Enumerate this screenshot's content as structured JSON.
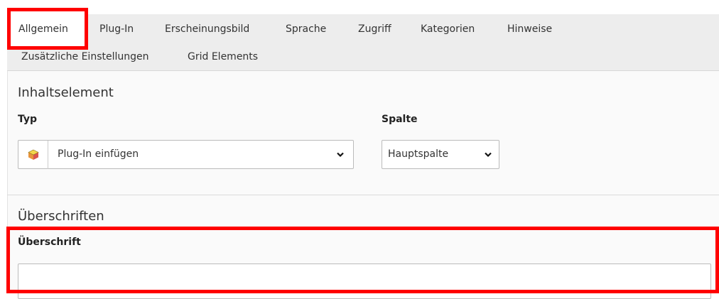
{
  "tabs": {
    "items": [
      {
        "label": "Allgemein"
      },
      {
        "label": "Plug-In"
      },
      {
        "label": "Erscheinungsbild"
      },
      {
        "label": "Sprache"
      },
      {
        "label": "Zugriff"
      },
      {
        "label": "Kategorien"
      },
      {
        "label": "Hinweise"
      },
      {
        "label": "Zusätzliche Einstellungen"
      },
      {
        "label": "Grid Elements"
      }
    ],
    "active": "Allgemein"
  },
  "section_content_element": {
    "title": "Inhaltselement",
    "type_label": "Typ",
    "type_value": "Plug-In einfügen",
    "type_icon": "plugin-cube-icon",
    "column_label": "Spalte",
    "column_value": "Hauptspalte"
  },
  "section_headers": {
    "title": "Überschriften",
    "header_label": "Überschrift",
    "header_value": ""
  },
  "colors": {
    "highlight": "#ff0000",
    "tab_bar": "#ededed",
    "content_bg": "#fafafa"
  }
}
